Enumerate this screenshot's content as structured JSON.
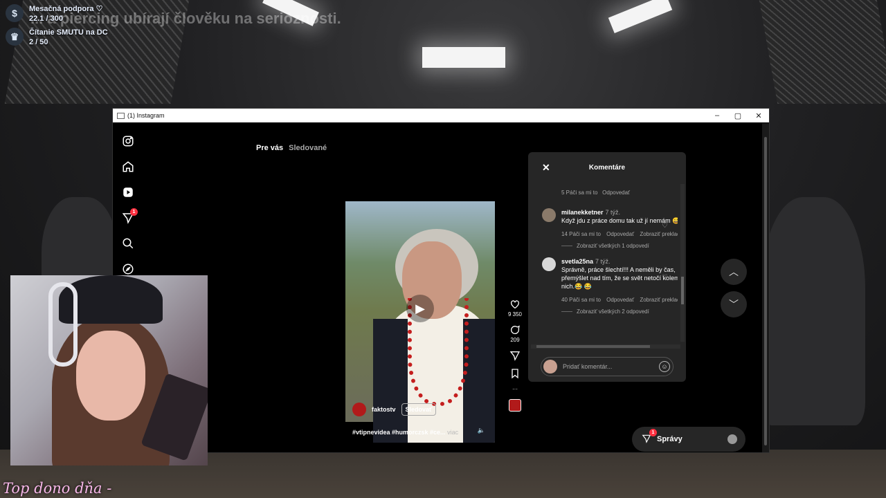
{
  "overlay": {
    "ticker": "... a piercing ubírají člověku na serióznosti.",
    "goals": [
      {
        "icon": "dollar-icon",
        "icon_glyph": "$",
        "label": "Mesačná podpora ♡",
        "progress": "22.1 / 300"
      },
      {
        "icon": "crown-icon",
        "icon_glyph": "♛",
        "label": "Čítanie SMUTU na DC",
        "progress": "2 / 50"
      }
    ],
    "top_dono": "Top dono dňa -"
  },
  "window": {
    "title": "(1) Instagram",
    "controls": {
      "minimize": "–",
      "maximize": "▢",
      "close": "✕"
    }
  },
  "sidebar": {
    "notification_badge": "1"
  },
  "tabs": {
    "for_you": "Pre vás",
    "following": "Sledované"
  },
  "reel": {
    "username": "faktostv",
    "follow_label": "Sledovať",
    "caption": "#vtipnevidea #humorczsk #ce...",
    "more_label": "viac",
    "play_glyph": "▶",
    "mute_glyph": "🔈"
  },
  "actions": {
    "likes": "9 350",
    "comments": "209",
    "more_glyph": "···"
  },
  "comments_panel": {
    "title": "Komentáre",
    "close_glyph": "✕",
    "top_meta": {
      "likes": "5 Páči sa mi to",
      "reply": "Odpovedať"
    },
    "comments": [
      {
        "username": "milanekketner",
        "time": "7 týž.",
        "text": "Když jdu z práce domu tak už jí nemám 😄",
        "likes": "14 Páči sa mi to",
        "reply": "Odpovedať",
        "translate": "Zobraziť preklad",
        "replies": "Zobraziť všetkých 1 odpovedí"
      },
      {
        "username": "svetla25na",
        "time": "7 týž.",
        "text": "Správně, práce šlechtí!!! A neměli by čas, přemýšlet nad tím, že se svět netočí kolem nich.😂 😂",
        "likes": "40 Páči sa mi to",
        "reply": "Odpovedať",
        "translate": "Zobraziť preklad",
        "replies": "Zobraziť všetkých 2 odpovedí"
      }
    ],
    "input_placeholder": "Pridať komentár...",
    "emoji_glyph": "☺"
  },
  "messages": {
    "label": "Správy",
    "badge": "1"
  },
  "nav": {
    "up_glyph": "︿",
    "down_glyph": "﹀"
  },
  "colors": {
    "badge_red": "#ff3040",
    "panel_bg": "#262626",
    "muted_text": "#a8a8a8",
    "dono_pink": "#f6b6e8"
  }
}
